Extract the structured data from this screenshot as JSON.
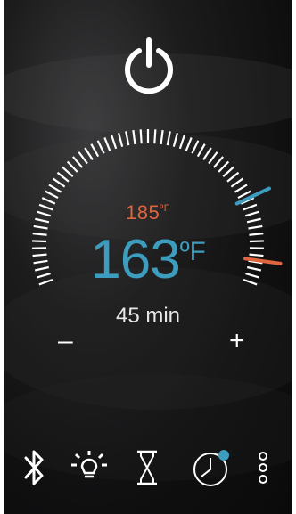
{
  "thermostat": {
    "setpoint_value": "185",
    "setpoint_unit": "ºF",
    "current_value": "163",
    "current_unit": "ºF",
    "timer": "45 min",
    "decrease_label": "–",
    "increase_label": "+",
    "setpoint_color": "#e0643e",
    "current_color": "#3d9dbf"
  },
  "icons": {
    "power": "power-icon",
    "bluetooth": "bluetooth-icon",
    "light": "light-bulb-icon",
    "timer": "hourglass-icon",
    "schedule": "clock-icon",
    "more": "more-vertical-icon"
  }
}
